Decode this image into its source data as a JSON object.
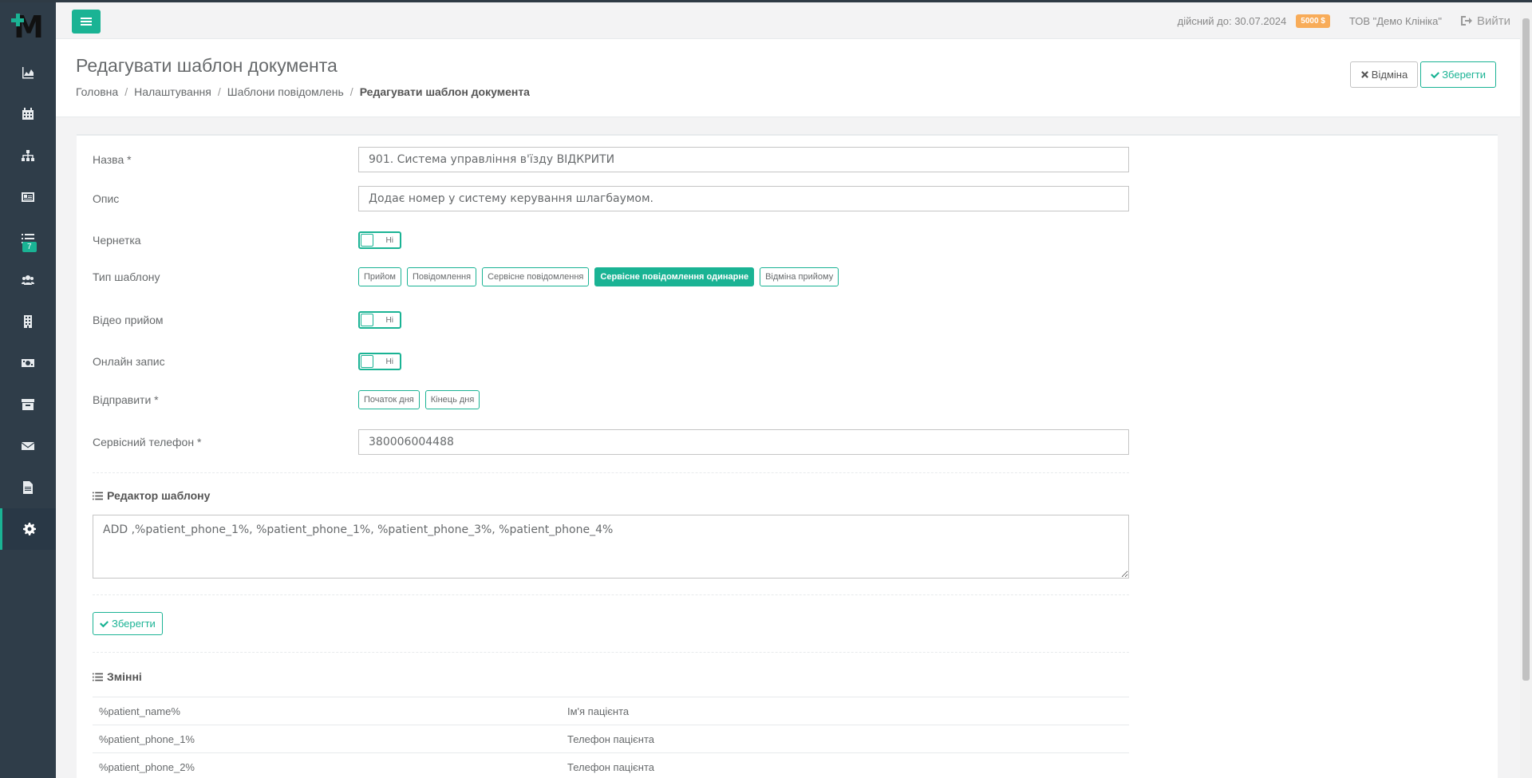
{
  "sidebar": {
    "logo": "M",
    "items": [
      {
        "icon": "chart-area-icon"
      },
      {
        "icon": "calendar-icon"
      },
      {
        "icon": "sitemap-icon"
      },
      {
        "icon": "id-card-icon"
      },
      {
        "icon": "list-icon",
        "badge": "7"
      },
      {
        "icon": "users-icon"
      },
      {
        "icon": "building-icon"
      },
      {
        "icon": "money-icon"
      },
      {
        "icon": "archive-icon"
      },
      {
        "icon": "envelope-icon"
      },
      {
        "icon": "file-icon"
      },
      {
        "icon": "gear-icon",
        "active": true
      }
    ]
  },
  "topbar": {
    "valid_until": "дійсний до: 30.07.2024",
    "price_badge": "5000 $",
    "company": "ТОВ \"Демо Клініка\"",
    "logout_label": "Вийти"
  },
  "heading": {
    "title": "Редагувати шаблон документа",
    "breadcrumb": [
      "Головна",
      "Налаштування",
      "Шаблони повідомлень",
      "Редагувати шаблон документа"
    ],
    "cancel_label": "Відміна",
    "save_label": "Зберегти"
  },
  "form": {
    "name_label": "Назва *",
    "name_value": "901. Система управління в'їзду ВІДКРИТИ",
    "description_label": "Опис",
    "description_value": "Додає номер у систему керування шлагбаумом.",
    "draft_label": "Чернетка",
    "draft_value": "Ні",
    "template_type_label": "Тип шаблону",
    "template_types": [
      "Прийом",
      "Повідомлення",
      "Сервісне повідомлення",
      "Сервісне повідомлення одинарне",
      "Відміна прийому"
    ],
    "template_type_selected": "Сервісне повідомлення одинарне",
    "video_label": "Відео прийом",
    "video_value": "Ні",
    "online_label": "Онлайн запис",
    "online_value": "Ні",
    "send_label": "Відправити *",
    "send_options": [
      "Початок дня",
      "Кінець дня"
    ],
    "phone_label": "Сервісний телефон *",
    "phone_value": "380006004488"
  },
  "editor": {
    "title": "Редактор шаблону",
    "content": "ADD ,%patient_phone_1%, %patient_phone_1%, %patient_phone_3%, %patient_phone_4%",
    "save_label": "Зберегти"
  },
  "variables": {
    "title": "Змінні",
    "rows": [
      {
        "name": "%patient_name%",
        "description": "Ім'я пацієнта"
      },
      {
        "name": "%patient_phone_1%",
        "description": "Телефон пацієнта"
      },
      {
        "name": "%patient_phone_2%",
        "description": "Телефон пацієнта"
      }
    ]
  },
  "colors": {
    "accent": "#1ab394",
    "sidebar": "#2f3d49",
    "badge": "#f8ac59"
  }
}
